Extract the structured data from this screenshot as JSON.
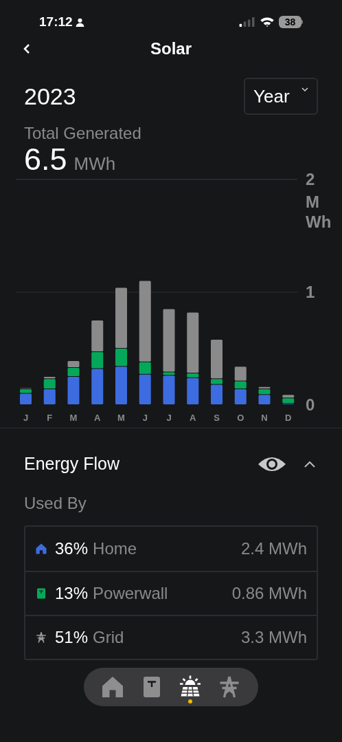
{
  "status_bar": {
    "time": "17:12",
    "battery": "38"
  },
  "header": {
    "title": "Solar"
  },
  "period": {
    "label": "2023",
    "range": "Year"
  },
  "summary": {
    "label": "Total Generated",
    "value": "6.5",
    "unit": "MWh"
  },
  "chart": {
    "chart_data": {
      "type": "bar",
      "stacked": true,
      "categories": [
        "J",
        "F",
        "M",
        "A",
        "M",
        "J",
        "J",
        "A",
        "S",
        "O",
        "N",
        "D"
      ],
      "ylim": [
        0,
        2
      ],
      "yticks": [
        0,
        1,
        2
      ],
      "ylabel": "M Wh",
      "series": [
        {
          "color": "#3d6ce0",
          "values": [
            0.1,
            0.14,
            0.25,
            0.32,
            0.34,
            0.27,
            0.26,
            0.24,
            0.18,
            0.14,
            0.09,
            0.01
          ]
        },
        {
          "color": "#05a85a",
          "values": [
            0.04,
            0.09,
            0.08,
            0.15,
            0.16,
            0.11,
            0.03,
            0.04,
            0.05,
            0.07,
            0.05,
            0.05
          ]
        },
        {
          "color": "#8a8a8a",
          "values": [
            0.01,
            0.02,
            0.06,
            0.28,
            0.54,
            0.72,
            0.56,
            0.54,
            0.35,
            0.13,
            0.02,
            0.03
          ]
        }
      ]
    }
  },
  "energy_flow": {
    "title": "Energy Flow",
    "expanded": true,
    "subtitle": "Used By",
    "rows": [
      {
        "kind": "home",
        "color": "#3d6ce0",
        "percent": "36%",
        "name": "Home",
        "value": "2.4 MWh"
      },
      {
        "kind": "powerwall",
        "color": "#05a85a",
        "percent": "13%",
        "name": "Powerwall",
        "value": "0.86 MWh"
      },
      {
        "kind": "grid",
        "color": "#9a9a9a",
        "percent": "51%",
        "name": "Grid",
        "value": "3.3 MWh"
      }
    ]
  },
  "nav": [
    {
      "kind": "home",
      "selected": false
    },
    {
      "kind": "powerwall",
      "selected": false
    },
    {
      "kind": "solar",
      "selected": true
    },
    {
      "kind": "grid",
      "selected": false
    }
  ]
}
